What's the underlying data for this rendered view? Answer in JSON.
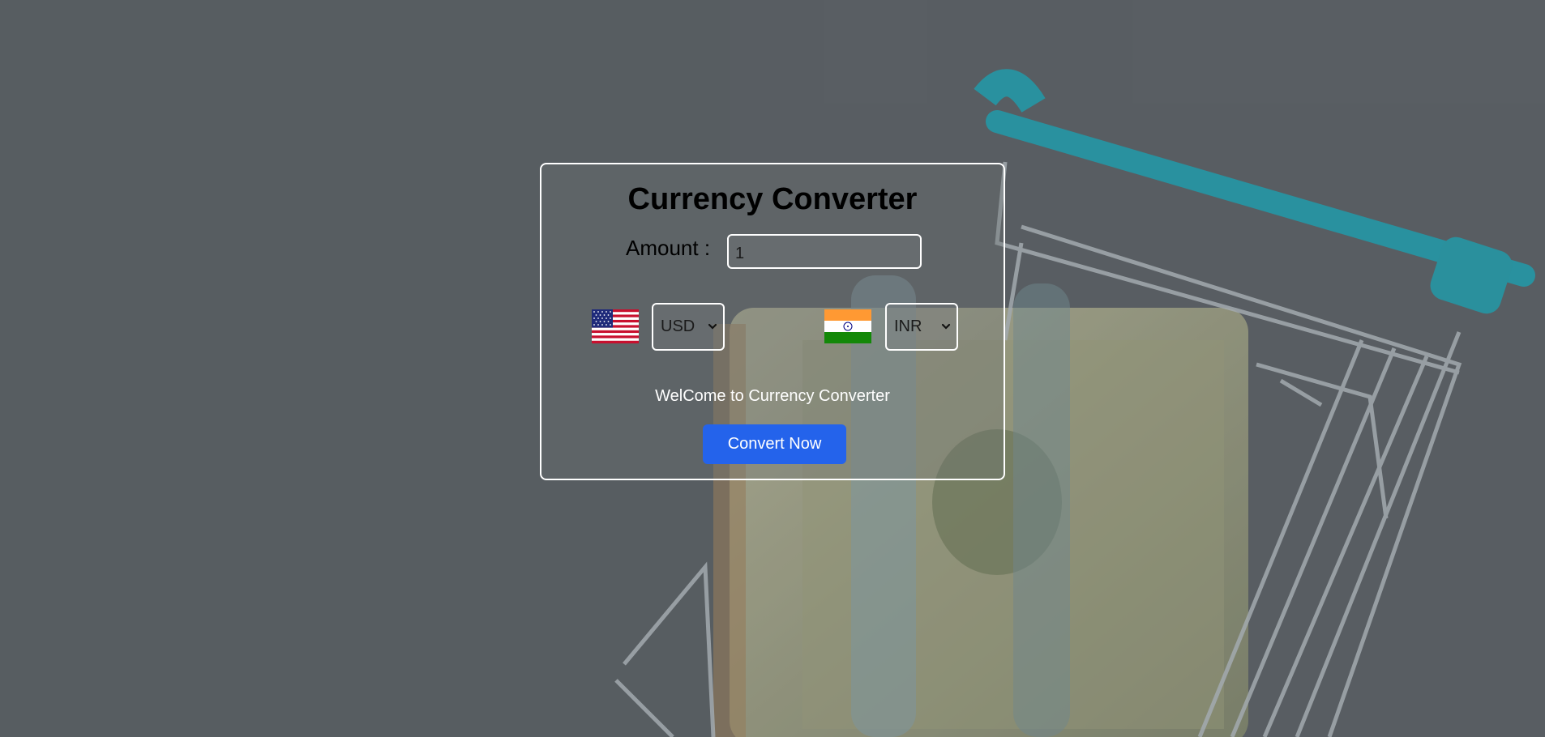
{
  "app": {
    "title": "Currency Converter"
  },
  "amount": {
    "label": "Amount :",
    "value": "1"
  },
  "from": {
    "flag_icon": "us-flag-icon",
    "selected": "USD"
  },
  "to": {
    "flag_icon": "india-flag-icon",
    "selected": "INR"
  },
  "message": "WelCome to Currency Converter",
  "button": {
    "label": "Convert Now"
  },
  "colors": {
    "accent": "#2463eb",
    "card_border": "#ffffff"
  }
}
